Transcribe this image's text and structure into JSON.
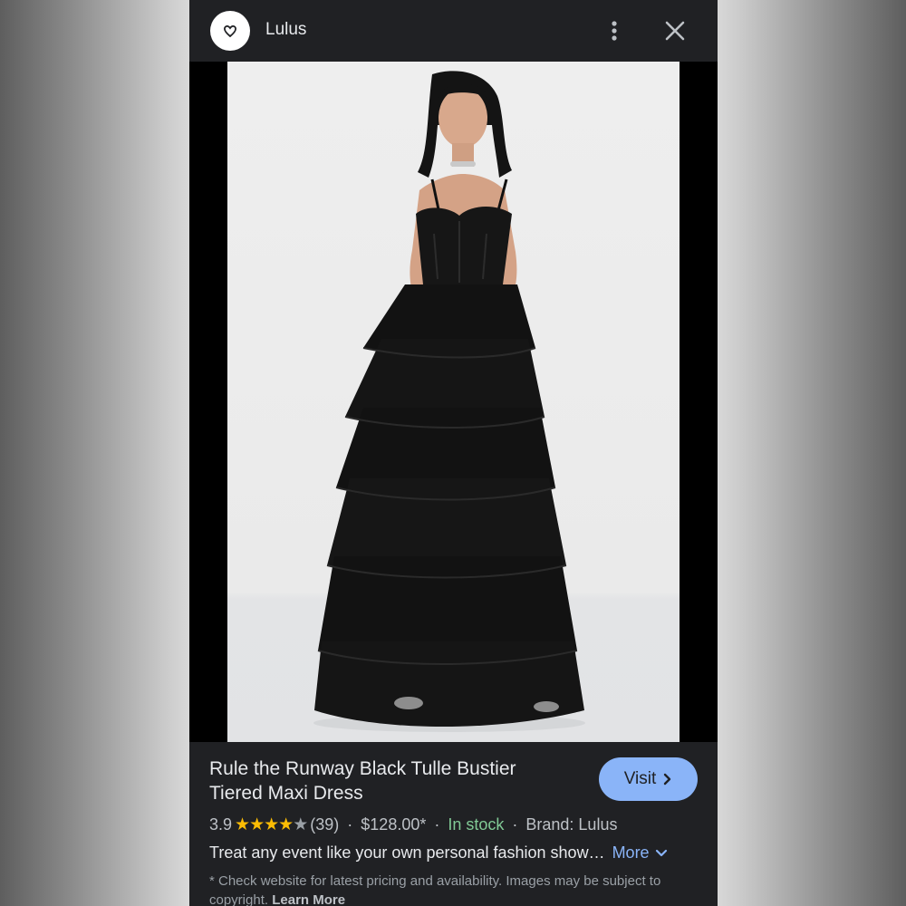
{
  "header": {
    "site_name": "Lulus",
    "logo_icon": "heart-logo-icon",
    "menu_icon": "more-vert-icon",
    "close_icon": "close-icon"
  },
  "image": {
    "subject": "model wearing black tiered tulle maxi dress"
  },
  "product": {
    "title": "Rule the Runway Black Tulle Bustier Tiered Maxi Dress",
    "visit_label": "Visit",
    "rating": "3.9",
    "stars_filled": 4,
    "stars_total": 5,
    "reviews": "(39)",
    "price": "$128.00*",
    "stock": "In stock",
    "brand": "Brand: Lulus",
    "separator": "·",
    "description": "Treat any event like your own personal fashion show…",
    "more_label": "More",
    "disclaimer": "* Check website for latest pricing and availability. Images may be subject to copyright.",
    "learn_more": "Learn More"
  },
  "colors": {
    "panel_bg": "#202124",
    "accent_blue": "#8ab4f8",
    "star_yellow": "#fbbc04",
    "stock_green": "#81c995"
  }
}
